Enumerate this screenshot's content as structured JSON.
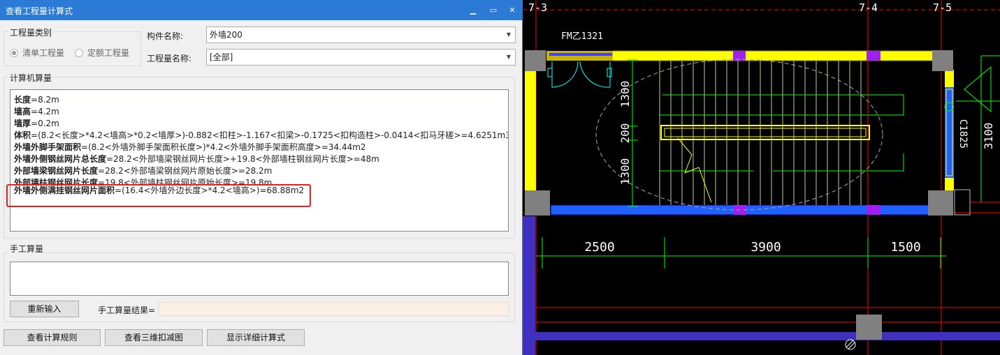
{
  "window": {
    "title": "查看工程量计算式",
    "minimize": "▁",
    "restore": "▭",
    "close": "✕"
  },
  "category": {
    "legend": "工程量类别",
    "options": [
      {
        "label": "清单工程量",
        "selected": true
      },
      {
        "label": "定额工程量",
        "selected": false
      }
    ]
  },
  "component": {
    "label": "构件名称:",
    "value": "外墙200"
  },
  "quantity": {
    "label": "工程量名称:",
    "value": "[全部]"
  },
  "computed": {
    "legend": "计算机算量",
    "lines": [
      {
        "name": "长度",
        "expr": "=8.2m"
      },
      {
        "name": "墙高",
        "expr": "=4.2m"
      },
      {
        "name": "墙厚",
        "expr": "=0.2m"
      },
      {
        "name": "体积",
        "expr": "=(8.2<长度>*4.2<墙高>*0.2<墙厚>)-0.882<扣柱>-1.167<扣梁>-0.1725<扣构造柱>-0.0414<扣马牙槎>=4.6251m3"
      },
      {
        "name": "外墙外脚手架面积",
        "expr": "=(8.2<外墙外脚手架面积长度>)*4.2<外墙外脚手架面积高度>=34.44m2"
      },
      {
        "name": "外墙外侧钢丝网片总长度",
        "expr": "=28.2<外部墙梁钢丝网片长度>+19.8<外部墙柱钢丝网片长度>=48m"
      },
      {
        "name": "外部墙梁钢丝网片长度",
        "expr": "=28.2<外部墙梁钢丝网片原始长度>=28.2m"
      },
      {
        "name": "外部墙柱钢丝网片长度",
        "expr": "=19.8<外部墙柱钢丝网片原始长度>=19.8m"
      },
      {
        "name": "外墙外侧满挂钢丝网片面积",
        "expr": "=(16.4<外墙外边长度>*4.2<墙高>)=68.88m2"
      }
    ]
  },
  "manual": {
    "legend": "手工算量",
    "reenter_label": "重新输入",
    "result_label": "手工算量结果="
  },
  "footer": {
    "rules_label": "查看计算规则",
    "view3d_label": "查看三维扣减图",
    "detail_label": "显示详细计算式"
  },
  "cad": {
    "axes": [
      "7-3",
      "7-4",
      "7-5"
    ],
    "door_label": "FM乙1321",
    "dims_bottom": [
      "2500",
      "3900",
      "1500"
    ],
    "dims_left": [
      "1300",
      "200",
      "1300"
    ],
    "dims_right": [
      "C1825",
      "3100"
    ],
    "colors": {
      "wall_yellow": "#ffff00",
      "wall_blue": "#2060ff",
      "column_gray": "#808080",
      "magenta": "#a020f0",
      "grid_red": "#ff0000",
      "dim_green": "#00ff00"
    }
  }
}
